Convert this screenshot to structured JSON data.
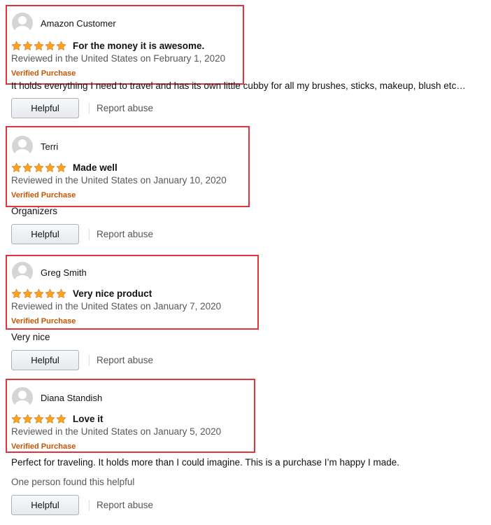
{
  "colors": {
    "highlight_border": "#e0363b",
    "star_fill": "#ffa41c",
    "star_stroke": "#de7921",
    "verified": "#c45500",
    "secondary_text": "#565959"
  },
  "reviews": [
    {
      "profile_name": "Amazon Customer",
      "rating": 5,
      "title": "For the money it is awesome.",
      "date": "Reviewed in the United States on February 1, 2020",
      "verified": "Verified Purchase",
      "body": "It holds everything I need to travel and has its own little cubby for all my brushes, sticks, makeup, blush etc…",
      "helpful_label": "Helpful",
      "report_label": "Report abuse"
    },
    {
      "profile_name": "Terri",
      "rating": 5,
      "title": "Made well",
      "date": "Reviewed in the United States on January 10, 2020",
      "verified": "Verified Purchase",
      "body": "Organizers",
      "helpful_label": "Helpful",
      "report_label": "Report abuse"
    },
    {
      "profile_name": "Greg Smith",
      "rating": 5,
      "title": "Very nice product",
      "date": "Reviewed in the United States on January 7, 2020",
      "verified": "Verified Purchase",
      "body": "Very nice",
      "helpful_label": "Helpful",
      "report_label": "Report abuse"
    },
    {
      "profile_name": "Diana Standish",
      "rating": 5,
      "title": "Love it",
      "date": "Reviewed in the United States on January 5, 2020",
      "verified": "Verified Purchase",
      "body": "Perfect for traveling. It holds more than I could imagine. This is a purchase I’m happy I made.",
      "helpful_count": "One person found this helpful",
      "helpful_label": "Helpful",
      "report_label": "Report abuse"
    }
  ]
}
